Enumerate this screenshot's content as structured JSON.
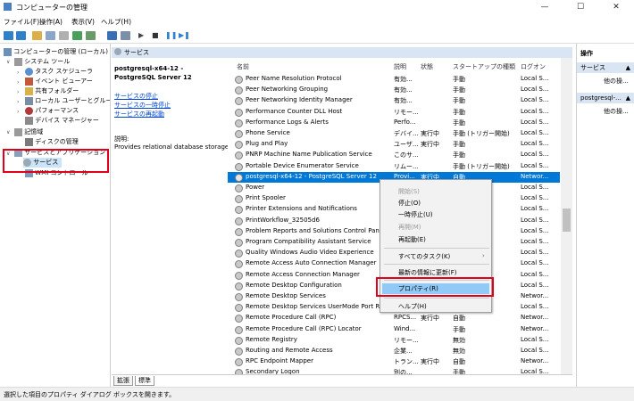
{
  "window": {
    "title": "コンピューターの管理",
    "minimize": "—",
    "maximize": "☐",
    "close": "✕"
  },
  "menu": [
    "ファイル(F)",
    "操作(A)",
    "表示(V)",
    "ヘルプ(H)"
  ],
  "toolbar_icons": [
    "back-arrow-icon",
    "forward-arrow-icon",
    "folder-up-icon",
    "show-tree-icon",
    "properties-icon",
    "refresh-icon",
    "export-icon",
    "help-icon",
    "console-icon",
    "play-icon",
    "stop-icon",
    "pause-icon",
    "restart-icon"
  ],
  "tree": [
    {
      "label": "コンピューターの管理 (ローカル)",
      "icon": "computer-icon"
    },
    {
      "label": "システム ツール",
      "icon": "tools-icon"
    },
    {
      "label": "タスク スケジューラ",
      "icon": "clock-icon"
    },
    {
      "label": "イベント ビューアー",
      "icon": "event-viewer-icon"
    },
    {
      "label": "共有フォルダー",
      "icon": "shared-folder-icon"
    },
    {
      "label": "ローカル ユーザーとグループ",
      "icon": "users-icon"
    },
    {
      "label": "パフォーマンス",
      "icon": "performance-icon"
    },
    {
      "label": "デバイス マネージャー",
      "icon": "device-manager-icon"
    },
    {
      "label": "記憶域",
      "icon": "storage-icon"
    },
    {
      "label": "ディスクの管理",
      "icon": "disk-icon"
    },
    {
      "label": "サービスとアプリケーション",
      "icon": "services-apps-icon"
    },
    {
      "label": "サービス",
      "icon": "services-icon"
    },
    {
      "label": "WMI コントロール",
      "icon": "wmi-icon"
    }
  ],
  "header": {
    "title": "サービス"
  },
  "detail": {
    "service_name": "postgresql-x64-12 - PostgreSQL Server 12",
    "link_stop": "サービスの停止",
    "link_pause": "サービスの一時停止",
    "link_restart": "サービスの再起動",
    "desc_label": "説明:",
    "desc_text": "Provides relational database storage."
  },
  "columns": {
    "name": "名前",
    "desc": "説明",
    "status": "状態",
    "startup": "スタートアップの種類",
    "logon": "ログオン"
  },
  "rows": [
    {
      "name": "Peer Name Resolution Protocol",
      "desc": "有効...",
      "status": "",
      "startup": "手動",
      "logon": "Local S..."
    },
    {
      "name": "Peer Networking Grouping",
      "desc": "有効...",
      "status": "",
      "startup": "手動",
      "logon": "Local S..."
    },
    {
      "name": "Peer Networking Identity Manager",
      "desc": "有効...",
      "status": "",
      "startup": "手動",
      "logon": "Local S..."
    },
    {
      "name": "Performance Counter DLL Host",
      "desc": "リモー...",
      "status": "",
      "startup": "手動",
      "logon": "Local S..."
    },
    {
      "name": "Performance Logs & Alerts",
      "desc": "Perfo...",
      "status": "",
      "startup": "手動",
      "logon": "Local S..."
    },
    {
      "name": "Phone Service",
      "desc": "デバイ...",
      "status": "実行中",
      "startup": "手動 (トリガー開始)",
      "logon": "Local S..."
    },
    {
      "name": "Plug and Play",
      "desc": "ユーザ...",
      "status": "実行中",
      "startup": "手動",
      "logon": "Local S..."
    },
    {
      "name": "PNRP Machine Name Publication Service",
      "desc": "このサ...",
      "status": "",
      "startup": "手動",
      "logon": "Local S..."
    },
    {
      "name": "Portable Device Enumerator Service",
      "desc": "リムー...",
      "status": "",
      "startup": "手動 (トリガー開始)",
      "logon": "Local S..."
    },
    {
      "name": "postgresql-x64-12 - PostgreSQL Server 12",
      "desc": "Provi...",
      "status": "実行中",
      "startup": "自動",
      "logon": "Networ..."
    },
    {
      "name": "Power",
      "desc": "",
      "status": "",
      "startup": "",
      "logon": "Local S..."
    },
    {
      "name": "Print Spooler",
      "desc": "",
      "status": "",
      "startup": "",
      "logon": "Local S..."
    },
    {
      "name": "Printer Extensions and Notifications",
      "desc": "",
      "status": "",
      "startup": "",
      "logon": "Local S..."
    },
    {
      "name": "PrintWorkflow_32505d6",
      "desc": "",
      "status": "",
      "startup": "",
      "logon": "Local S..."
    },
    {
      "name": "Problem Reports and Solutions Control Panel",
      "desc": "",
      "status": "",
      "startup": "",
      "logon": "Local S..."
    },
    {
      "name": "Program Compatibility Assistant Service",
      "desc": "",
      "status": "",
      "startup": "",
      "logon": "Local S..."
    },
    {
      "name": "Quality Windows Audio Video Experience",
      "desc": "",
      "status": "",
      "startup": "",
      "logon": "Local S..."
    },
    {
      "name": "Remote Access Auto Connection Manager",
      "desc": "",
      "status": "",
      "startup": "",
      "logon": "Local S..."
    },
    {
      "name": "Remote Access Connection Manager",
      "desc": "",
      "status": "",
      "startup": "",
      "logon": "Local S..."
    },
    {
      "name": "Remote Desktop Configuration",
      "desc": "",
      "status": "",
      "startup": "",
      "logon": "Local S..."
    },
    {
      "name": "Remote Desktop Services",
      "desc": "",
      "status": "",
      "startup": "",
      "logon": "Networ..."
    },
    {
      "name": "Remote Desktop Services UserMode Port Redi...",
      "desc": "",
      "status": "",
      "startup": "",
      "logon": "Local S..."
    },
    {
      "name": "Remote Procedure Call (RPC)",
      "desc": "RPCS...",
      "status": "実行中",
      "startup": "自動",
      "logon": "Networ..."
    },
    {
      "name": "Remote Procedure Call (RPC) Locator",
      "desc": "Wind...",
      "status": "",
      "startup": "手動",
      "logon": "Networ..."
    },
    {
      "name": "Remote Registry",
      "desc": "リモー...",
      "status": "",
      "startup": "無効",
      "logon": "Local S..."
    },
    {
      "name": "Routing and Remote Access",
      "desc": "企業...",
      "status": "",
      "startup": "無効",
      "logon": "Local S..."
    },
    {
      "name": "RPC Endpoint Mapper",
      "desc": "トラン...",
      "status": "実行中",
      "startup": "自動",
      "logon": "Networ..."
    },
    {
      "name": "Secondary Logon",
      "desc": "別の...",
      "status": "",
      "startup": "手動",
      "logon": "Local S..."
    }
  ],
  "context_menu": [
    {
      "label": "開始(S)",
      "disabled": true
    },
    {
      "label": "停止(O)",
      "disabled": false
    },
    {
      "label": "一時停止(U)",
      "disabled": false
    },
    {
      "label": "再開(M)",
      "disabled": true
    },
    {
      "label": "再起動(E)",
      "disabled": false
    },
    {
      "label": "すべてのタスク(K)",
      "disabled": false,
      "submenu": true
    },
    {
      "label": "最新の情報に更新(F)",
      "disabled": false
    },
    {
      "label": "プロパティ(R)",
      "disabled": false,
      "highlighted": true
    },
    {
      "label": "ヘルプ(H)",
      "disabled": false
    }
  ],
  "tabs": [
    "拡張",
    "標準"
  ],
  "actions": {
    "header": "操作",
    "section1": "サービス",
    "more1": "他の操...",
    "section2": "postgresql-...",
    "more2": "他の操..."
  },
  "status_text": "選択した項目のプロパティ ダイアログ ボックスを開きます。",
  "colors": {
    "selection": "#0078d7",
    "highlight_box": "#e0001a",
    "menu_hover": "#91c9f7",
    "header_bg": "#d9e5f3"
  }
}
